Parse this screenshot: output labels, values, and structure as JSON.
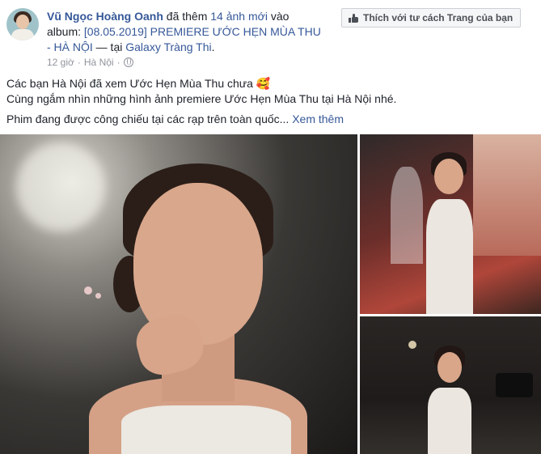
{
  "post": {
    "author": "Vũ Ngọc Hoàng Oanh",
    "action_pre": " đã thêm ",
    "photo_count_link": "14 ảnh mới",
    "action_mid": " vào album: ",
    "album_link": "[08.05.2019] PREMIERE ƯỚC HẸN MÙA THU - HÀ NỘI",
    "location_sep": " — tại ",
    "location_link": "Galaxy Tràng Thi",
    "location_end": ".",
    "time": "12 giờ",
    "dot": "·",
    "place": "Hà Nội",
    "dot2": "·",
    "privacy_icon": "globe-icon",
    "like_as_page_label": "Thích với tư cách Trang của bạn",
    "text_line1": "Các bạn Hà Nội đã xem Ước Hẹn Mùa Thu chưa 🥰",
    "text_line2": "Cùng ngắm nhìn những hình ảnh premiere Ước Hẹn Mùa Thu tại Hà Nội nhé.",
    "text_line3": "Phim đang được công chiếu tại các rạp trên toàn quốc...",
    "see_more": "Xem thêm"
  },
  "colors": {
    "link": "#365899",
    "meta": "#90949c",
    "text": "#1d2129",
    "button_bg": "#f5f6f7"
  }
}
